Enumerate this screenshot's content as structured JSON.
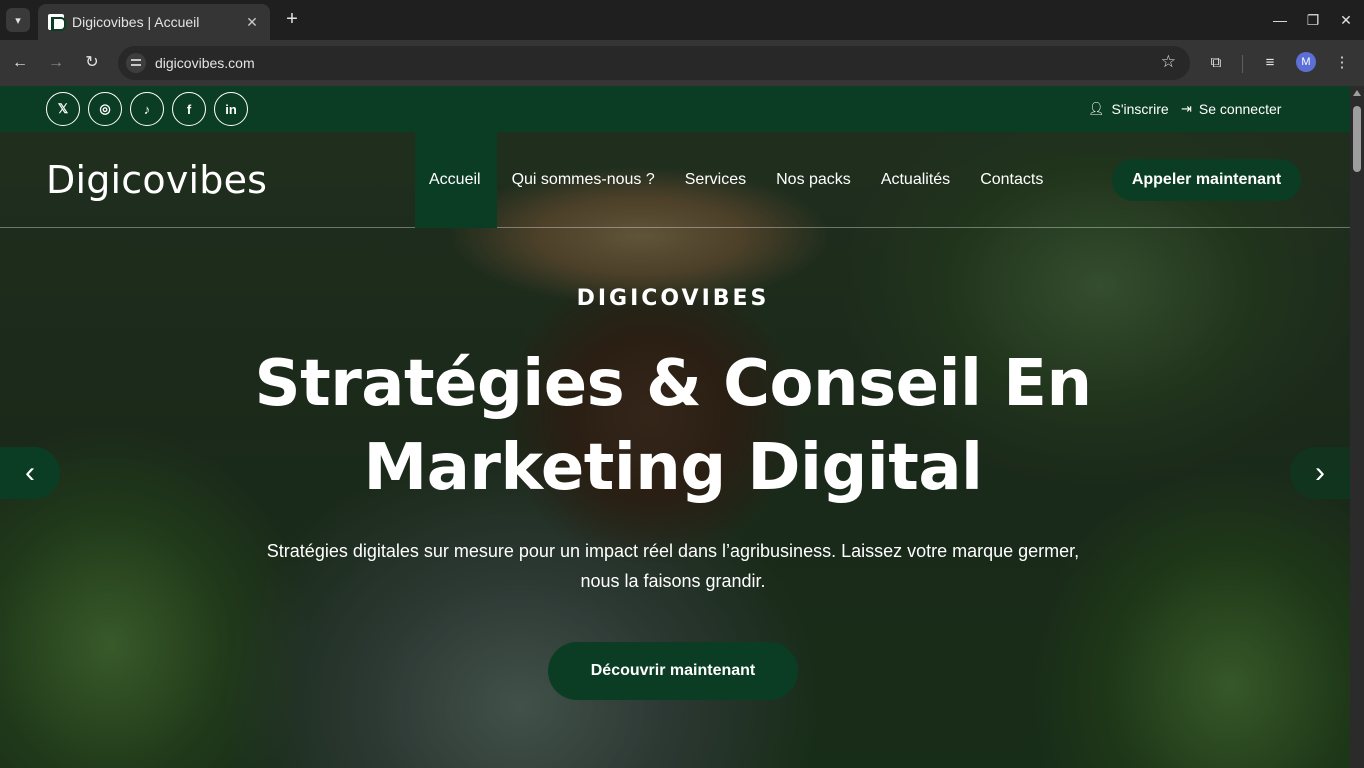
{
  "browser": {
    "tab_title": "Digicovibes | Accueil",
    "tab_close": "✕",
    "new_tab": "+",
    "url": "digicovibes.com",
    "profile_initial": "M"
  },
  "site": {
    "social": [
      "𝕏",
      "◎",
      "♪",
      "f",
      "in"
    ],
    "auth": {
      "signup": "S'inscrire",
      "login": "Se connecter"
    },
    "logo": "Digicovibes",
    "nav": [
      "Accueil",
      "Qui sommes-nous ?",
      "Services",
      "Nos packs",
      "Actualités",
      "Contacts"
    ],
    "call_button": "Appeler maintenant",
    "hero": {
      "kicker": "DIGICOVIBES",
      "headline": "Stratégies & Conseil En Marketing Digital",
      "subtitle": "Stratégies digitales sur mesure pour un impact réel dans l’agribusiness. Laissez votre marque germer, nous la faisons grandir.",
      "cta": "Découvrir maintenant"
    },
    "colors": {
      "brand_green": "#0b3d24"
    }
  }
}
